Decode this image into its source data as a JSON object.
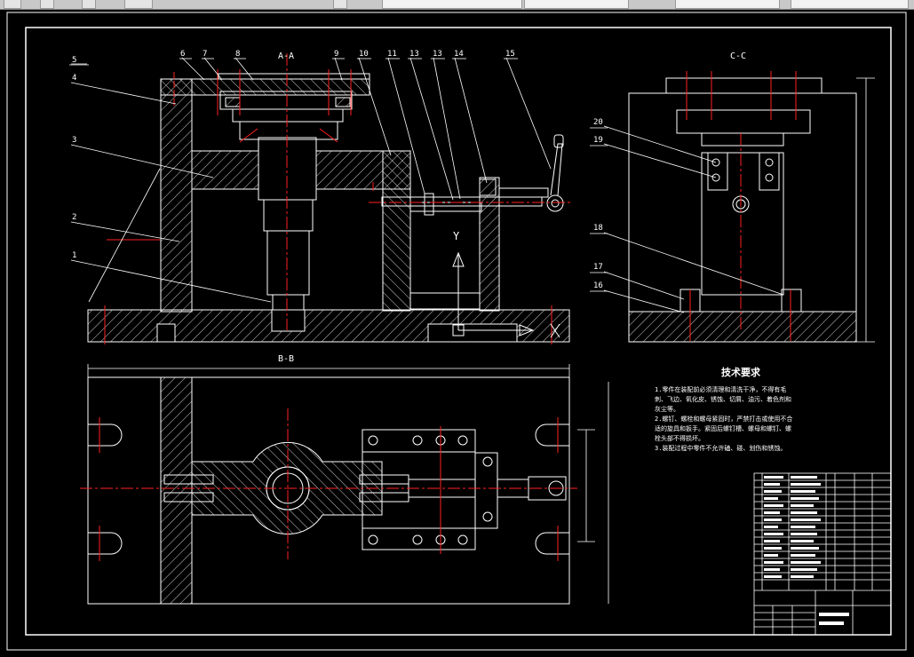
{
  "toolbar": {
    "tabs": [
      "",
      "",
      "",
      "",
      ""
    ],
    "search_placeholder": ""
  },
  "drawing": {
    "views": {
      "section_aa": "A-A",
      "section_cc": "C-C",
      "section_bb": "B-B"
    },
    "balloons_top": [
      "5",
      "4",
      "6",
      "7",
      "8",
      "9",
      "10",
      "11",
      "13",
      "13",
      "14",
      "15"
    ],
    "balloons_left": [
      "3",
      "2",
      "1"
    ],
    "balloons_right": [
      "20",
      "19",
      "18",
      "17",
      "16"
    ],
    "arrow_label": "Y",
    "tech_req": {
      "title": "技术要求",
      "lines": [
        "1.零件在装配前必须清理和清洗干净，不得有毛",
        "刺、飞边、氧化皮、锈蚀、切屑、油污、着色剂和",
        "灰尘等。",
        "2.螺钉、螺栓和螺母紧固时，严禁打击或使用不合",
        "适的旋具和扳手。紧固后螺钉槽、螺母和螺钉、螺",
        "栓头部不得损坏。",
        "3.装配过程中零件不允许磕、碰、划伤和锈蚀。"
      ]
    },
    "colors": {
      "outline": "#ffffff",
      "centerline": "#ff2020",
      "hatch": "#ffffff",
      "background": "#000000"
    }
  }
}
